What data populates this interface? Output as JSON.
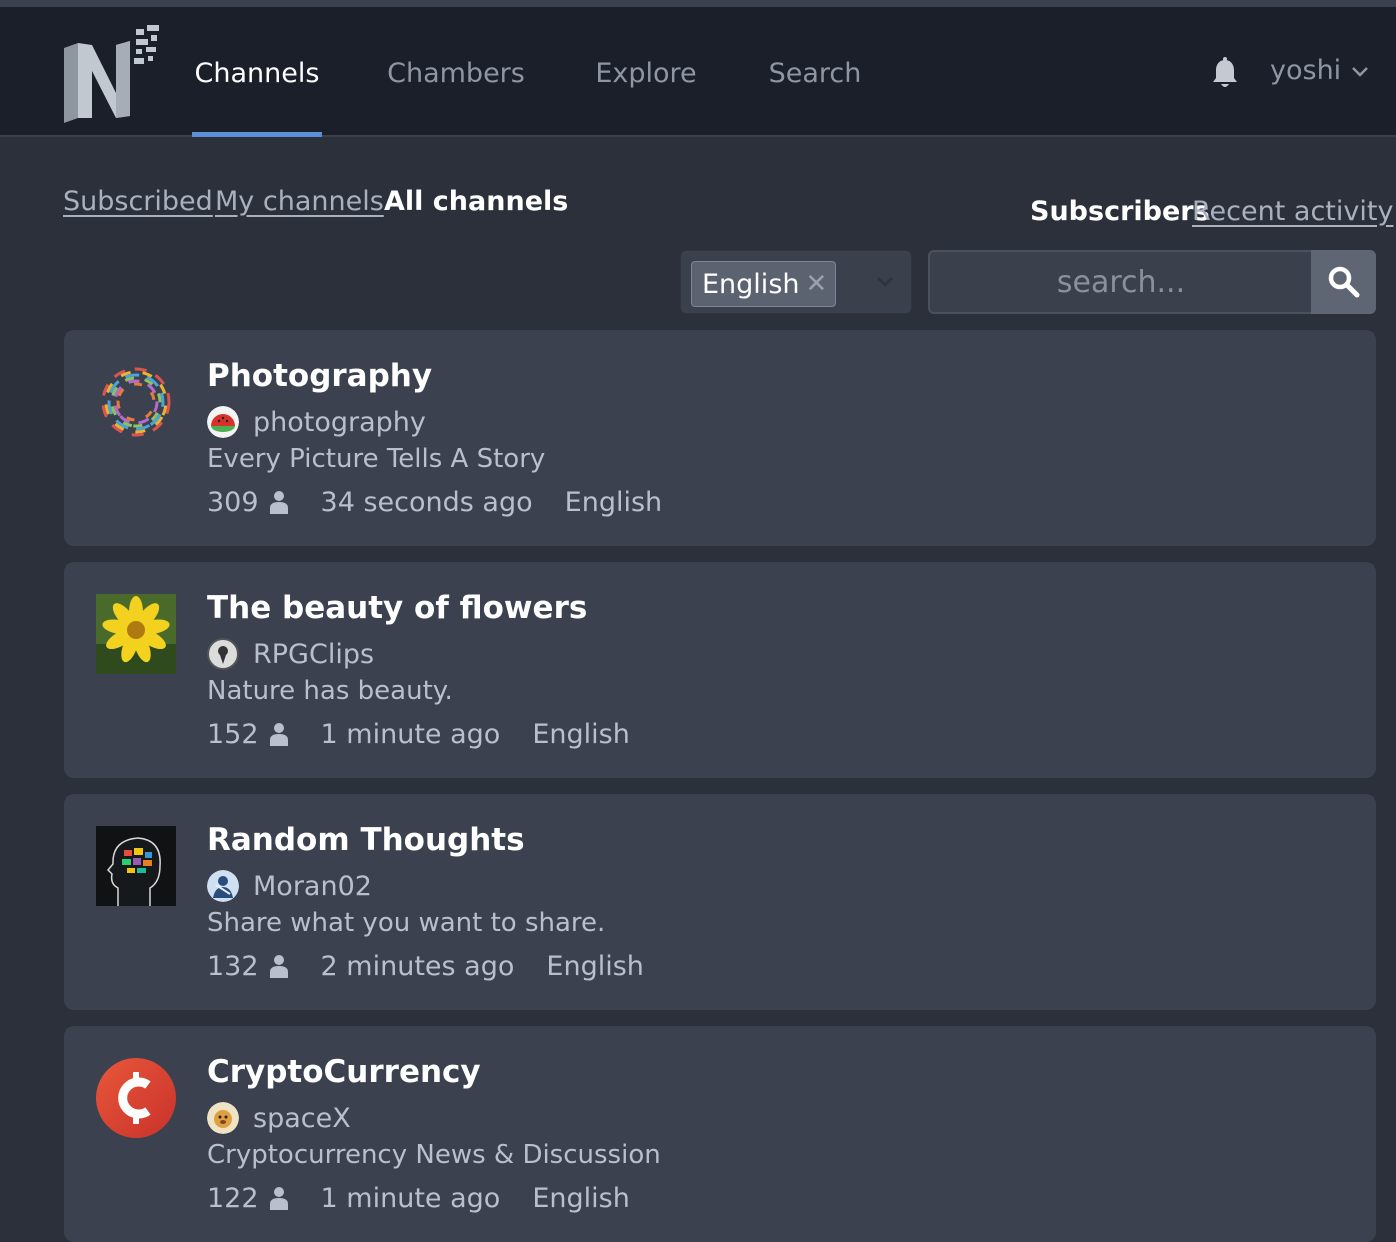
{
  "nav": {
    "items": [
      {
        "label": "Channels",
        "active": true
      },
      {
        "label": "Chambers",
        "active": false
      },
      {
        "label": "Explore",
        "active": false
      },
      {
        "label": "Search",
        "active": false
      }
    ],
    "username": "yoshi"
  },
  "filters": {
    "subscribed": "Subscribed",
    "my_channels": "My channels",
    "all_channels": "All channels",
    "active": "all_channels"
  },
  "sort": {
    "subscribers": "Subscribers",
    "recent_activity": "Recent activity",
    "active": "subscribers"
  },
  "language_filter": {
    "selected": "English",
    "remove_symbol": "✕"
  },
  "search": {
    "placeholder": "search...",
    "value": ""
  },
  "channels": [
    {
      "title": "Photography",
      "owner": "photography",
      "description": "Every Picture Tells A Story",
      "subscribers": "309",
      "last_activity": "34 seconds ago",
      "language": "English"
    },
    {
      "title": "The beauty of flowers",
      "owner": "RPGClips",
      "description": "Nature has beauty.",
      "subscribers": "152",
      "last_activity": "1 minute ago",
      "language": "English"
    },
    {
      "title": "Random Thoughts",
      "owner": "Moran02",
      "description": "Share what you want to share.",
      "subscribers": "132",
      "last_activity": "2 minutes ago",
      "language": "English"
    },
    {
      "title": "CryptoCurrency",
      "owner": "spaceX",
      "description": "Cryptocurrency News & Discussion",
      "subscribers": "122",
      "last_activity": "1 minute ago",
      "language": "English"
    }
  ],
  "colors": {
    "background": "#2b303b",
    "navbar": "#1b1f2a",
    "card": "#3b414f",
    "accent": "#5b8fd6",
    "crypto_brand": "#e0442a"
  }
}
